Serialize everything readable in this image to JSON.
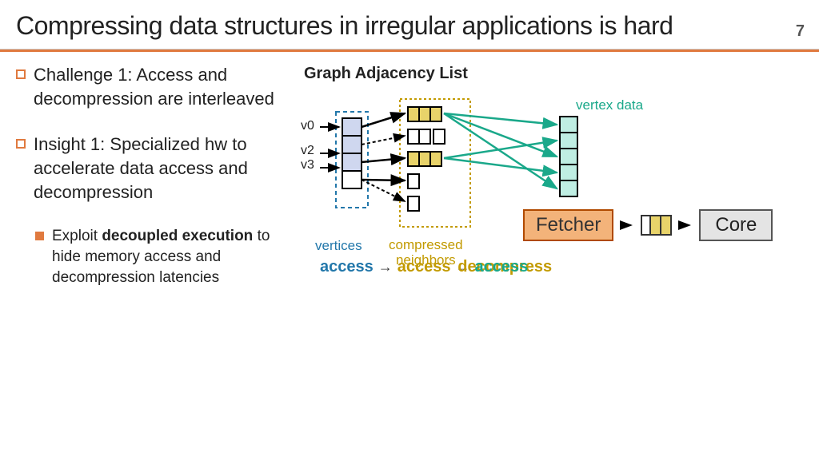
{
  "title": "Compressing data structures in irregular applications is hard",
  "pageNumber": "7",
  "bullets": {
    "b1": "Challenge 1: Access and decompression are interleaved",
    "b2": "Insight 1: Specialized hw to accelerate data access and decompression",
    "sub_pre": "Exploit ",
    "sub_bold": "decoupled execution",
    "sub_post": " to hide memory access and decompression latencies"
  },
  "diagram": {
    "title": "Graph Adjacency List",
    "v0": "v0",
    "v2": "v2",
    "v3": "v3",
    "vertices": "vertices",
    "compressed_neighbors": "compressed\nneighbors",
    "vertex_data": "vertex data",
    "fetcher": "Fetcher",
    "core": "Core"
  },
  "sequence": {
    "a1": "access",
    "a2": "access",
    "a3_overlay1": "access",
    "a3_overlay2": "decompress"
  },
  "colors": {
    "accent": "#e07a3f",
    "blue": "#2277aa",
    "gold": "#c29a00",
    "teal": "#1aa88a"
  }
}
